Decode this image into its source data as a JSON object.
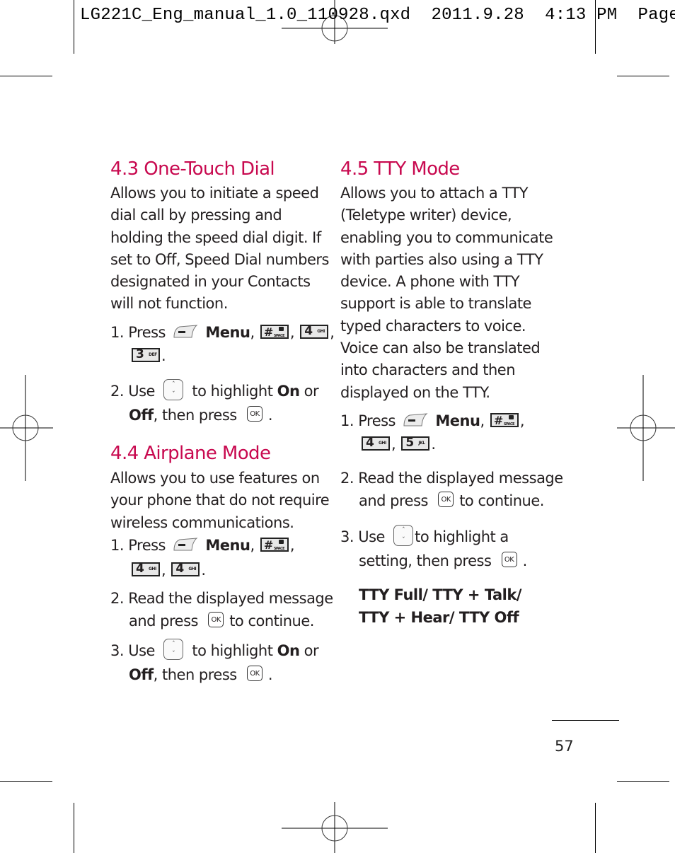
{
  "slug": "LG221C_Eng_manual_1.0_110928.qxd  2011.9.28  4:13 PM  Page",
  "page_number": "57",
  "accent_color": "#c8094f",
  "icons": {
    "soft_key": "left-soft-key-icon",
    "nav_key": "up-down-navigation-key-icon",
    "ok_key": "ok-key-icon",
    "hash_key": "hash-space-lock-key-icon"
  },
  "keys": {
    "hash": {
      "num": "#",
      "sub": "SPACE"
    },
    "k4": {
      "num": "4",
      "sub": "GHI"
    },
    "k3": {
      "num": "3",
      "sub": "DEF"
    },
    "k5": {
      "num": "5",
      "sub": "JKL"
    },
    "ok": "OK",
    "nav_up": "ˆ",
    "nav_down": "ˇ"
  },
  "sections": {
    "one_touch": {
      "title": "4.3 One-Touch Dial",
      "body": [
        "Allows you to initiate a speed",
        "dial call by pressing and",
        "holding the speed dial digit. If",
        "set to Off, Speed Dial numbers",
        "designated in your Contacts",
        "will not function."
      ],
      "step1": {
        "num": "1.",
        "press": "Press",
        "menu": "Menu",
        "comma": ",",
        "period": "."
      },
      "step2": {
        "num": "2.",
        "use": "Use",
        "highlight": "to highlight",
        "on": "On",
        "or": "or",
        "off": "Off",
        "then_press": ", then press",
        "period": "."
      }
    },
    "airplane": {
      "title": "4.4 Airplane Mode",
      "body": [
        "Allows you to use features on",
        "your phone that do not require",
        "wireless communications."
      ],
      "step1": {
        "num": "1.",
        "press": "Press",
        "menu": "Menu",
        "comma": ",",
        "period": "."
      },
      "step2": {
        "num": "2.",
        "line1": "Read the displayed message",
        "and_press": "and press",
        "to_continue": "to continue."
      },
      "step3": {
        "num": "3.",
        "use": "Use",
        "highlight": "to highlight",
        "on": "On",
        "or": "or",
        "off": "Off",
        "then_press": ", then press",
        "period": "."
      }
    },
    "tty": {
      "title": "4.5 TTY Mode",
      "body": [
        "Allows you to attach a TTY",
        "(Teletype writer) device,",
        "enabling you to communicate",
        "with parties also using a TTY",
        "device. A phone with TTY",
        "support is able to translate",
        "typed characters to voice.",
        "Voice can also be translated",
        "into characters and then",
        "displayed on the TTY."
      ],
      "step1": {
        "num": "1.",
        "press": "Press",
        "menu": "Menu",
        "comma": ",",
        "period": "."
      },
      "step2": {
        "num": "2.",
        "line1": "Read the displayed message",
        "and_press": "and press",
        "to_continue": "to continue."
      },
      "step3": {
        "num": "3.",
        "use": "Use",
        "highlight": "to highlight a",
        "setting": "setting, then press",
        "period": "."
      },
      "options": [
        "TTY Full/ TTY + Talk/",
        "TTY + Hear/ TTY Off"
      ]
    }
  }
}
